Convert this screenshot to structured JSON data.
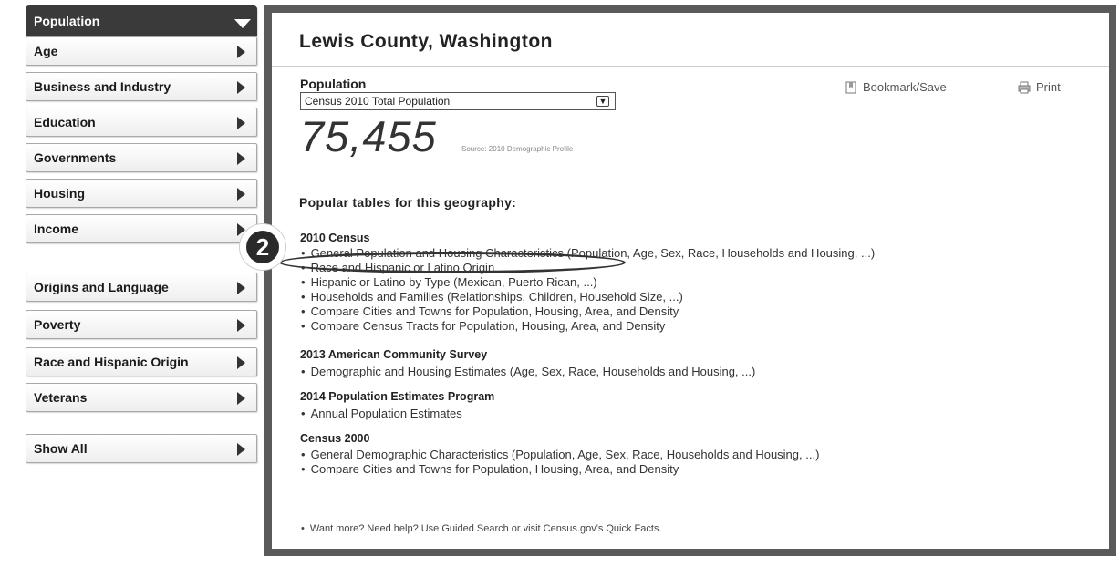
{
  "sidebar": {
    "header": "Population",
    "items": [
      {
        "label": "Age"
      },
      {
        "label": "Business and Industry"
      },
      {
        "label": "Education"
      },
      {
        "label": "Governments"
      },
      {
        "label": "Housing"
      },
      {
        "label": "Income"
      },
      {
        "label": "Origins and Language"
      },
      {
        "label": "Poverty"
      },
      {
        "label": "Race and Hispanic Origin"
      },
      {
        "label": "Veterans"
      }
    ],
    "show_all": "Show All"
  },
  "main": {
    "title": "Lewis County, Washington",
    "population_label": "Population",
    "select_value": "Census 2010 Total Population",
    "big_number": "75,455",
    "source": "Source: 2010 Demographic Profile",
    "bookmark_label": "Bookmark/Save",
    "print_label": "Print",
    "popular_heading": "Popular tables for this geography:",
    "sections": [
      {
        "title": "2010 Census",
        "links": [
          "General Population and Housing Characteristics (Population, Age, Sex, Race, Households and Housing, ...)",
          "Race and Hispanic or Latino Origin",
          "Hispanic or Latino by Type (Mexican, Puerto Rican, ...)",
          "Households and Families (Relationships, Children, Household Size, ...)",
          "Compare Cities and Towns for Population, Housing, Area, and Density",
          "Compare Census Tracts for Population, Housing, Area, and Density"
        ]
      },
      {
        "title": "2013 American Community Survey",
        "links": [
          "Demographic and Housing Estimates (Age, Sex, Race, Households and Housing, ...)"
        ]
      },
      {
        "title": "2014 Population Estimates Program",
        "links": [
          "Annual Population Estimates"
        ]
      },
      {
        "title": "Census 2000",
        "links": [
          "General Demographic Characteristics (Population, Age, Sex, Race, Households and Housing, ...)",
          "Compare Cities and Towns for Population, Housing, Area, and Density"
        ]
      }
    ],
    "footer_note": "Want more? Need help? Use Guided Search or visit Census.gov's Quick Facts."
  },
  "annotation": {
    "step_number": "2"
  }
}
